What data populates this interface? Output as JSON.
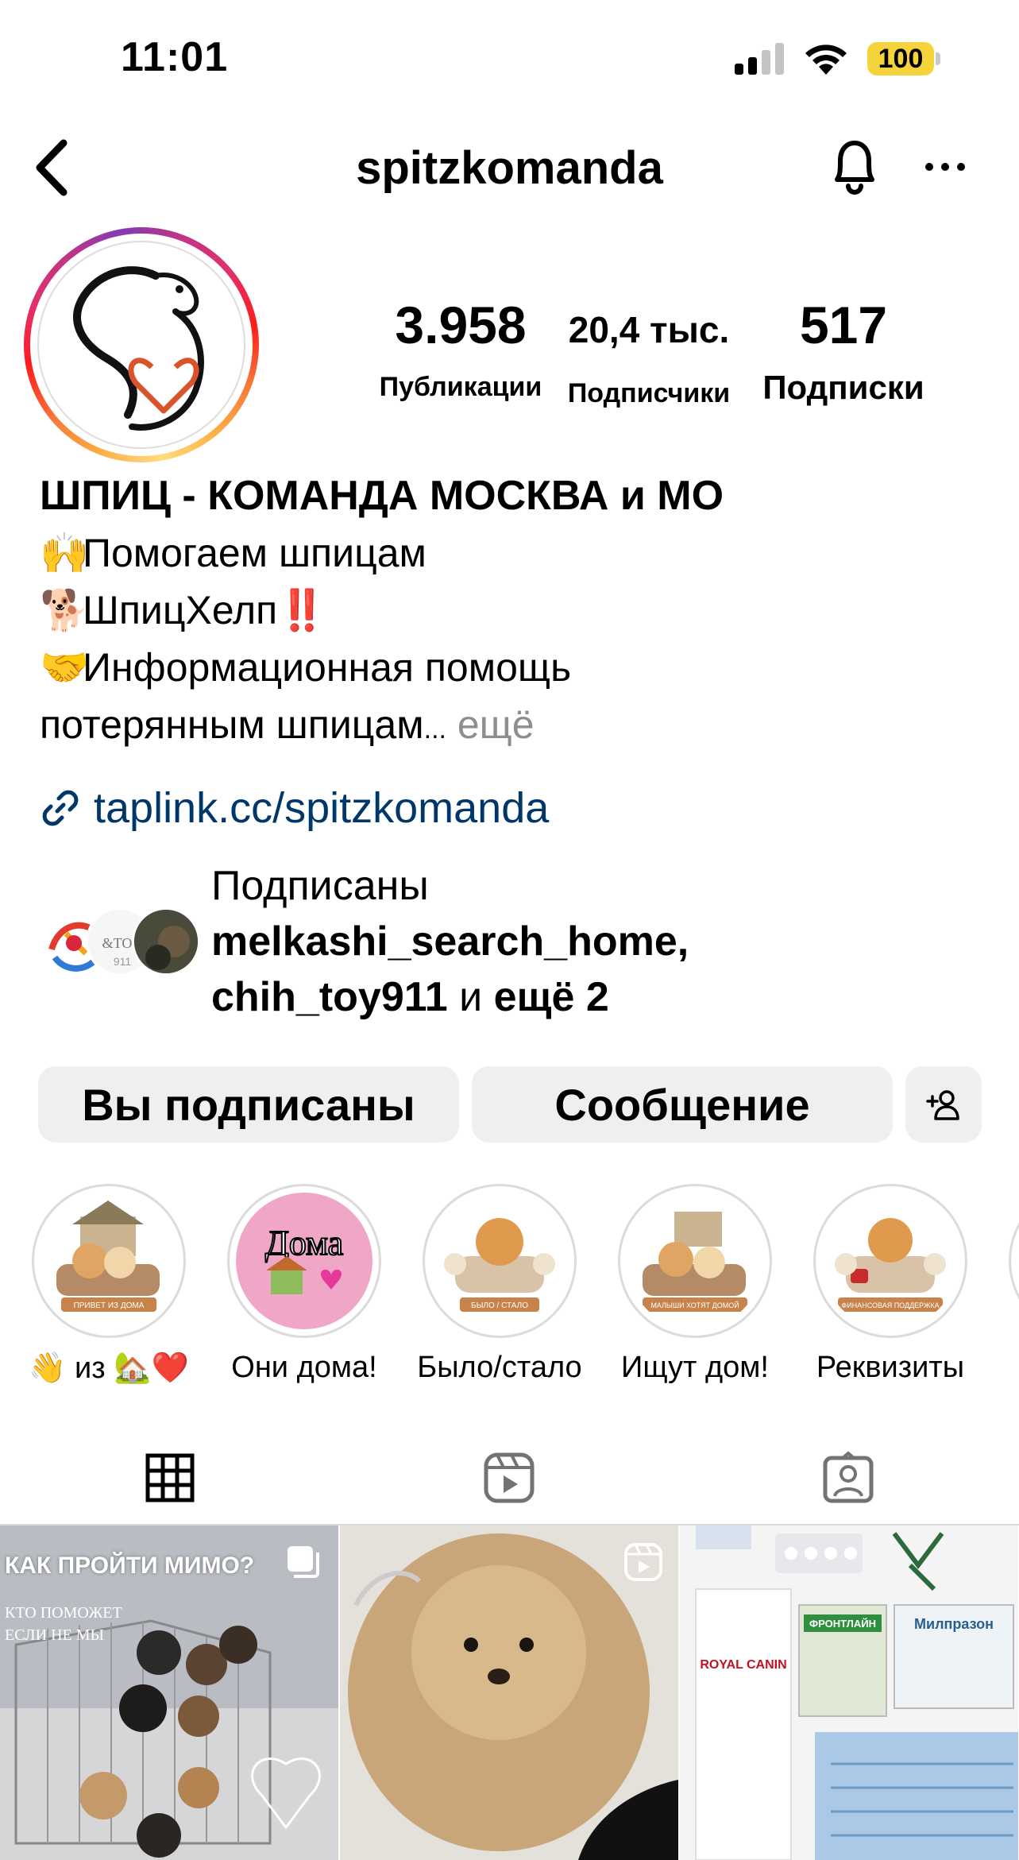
{
  "status_bar": {
    "time": "11:01",
    "battery": "100",
    "battery_color": "#f5d33b"
  },
  "header": {
    "username": "spitzkomanda",
    "back_icon": "chevron-left-icon",
    "bell_icon": "bell-icon",
    "more_icon": "more-horizontal-icon"
  },
  "profile": {
    "stats": [
      {
        "value": "3.958",
        "label": "Публикации"
      },
      {
        "value": "20,4 тыс.",
        "label": "Подписчики"
      },
      {
        "value": "517",
        "label": "Подписки"
      }
    ],
    "bio": {
      "title": "ШПИЦ - КОМАНДА МОСКВА и МО",
      "line1_emoji": "🙌",
      "line1": "Помогаем шпицам",
      "line2_emoji": "🐕",
      "line2": "ШпицХелп",
      "line2_suffix": "‼️",
      "line3_emoji": "🤝",
      "line3": "Информационная помощь",
      "line4": "потерянным шпицам",
      "ellipsis": "...",
      "more": " ещё"
    },
    "link": {
      "icon": "link-icon",
      "text": "taplink.cc/spitzkomanda",
      "color": "#00376b"
    },
    "followed_by": {
      "prefix": "Подписаны",
      "user1": "melkashi_search_home",
      "sep": ",",
      "user2": "chih_toy911",
      "and": " и ",
      "rest": "ещё 2"
    }
  },
  "buttons": {
    "following": "Вы подписаны",
    "message": "Сообщение",
    "add_user_icon": "add-user-icon"
  },
  "highlights": [
    {
      "label": "👋 из 🏡❤️",
      "caption": "ПРИВЕТ ИЗ ДОМА"
    },
    {
      "label": "Они дома!",
      "caption": "Дома"
    },
    {
      "label": "Было/стало",
      "caption": "БЫЛО / СТАЛО"
    },
    {
      "label": "Ищут дом!",
      "caption": "МАЛЫШИ ХОТЯТ ДОМОЙ"
    },
    {
      "label": "Реквизиты",
      "caption": "ФИНАНСОВАЯ ПОДДЕРЖКА"
    }
  ],
  "tabs": [
    {
      "name": "grid",
      "icon": "grid-icon",
      "active": true
    },
    {
      "name": "reels",
      "icon": "reels-icon",
      "active": false
    },
    {
      "name": "tagged",
      "icon": "tagged-icon",
      "active": false
    }
  ],
  "posts": [
    {
      "title": "КАК ПРОЙТИ МИМО?",
      "subtitle1": "КТО ПОМОЖЕТ",
      "subtitle2": "ЕСЛИ НЕ МЫ",
      "badge": "carousel-icon"
    },
    {
      "badge": "reels-icon"
    },
    {
      "labels": [
        "ROYAL CANIN",
        "ФРОНТЛАЙН",
        "Милпразон"
      ]
    }
  ]
}
